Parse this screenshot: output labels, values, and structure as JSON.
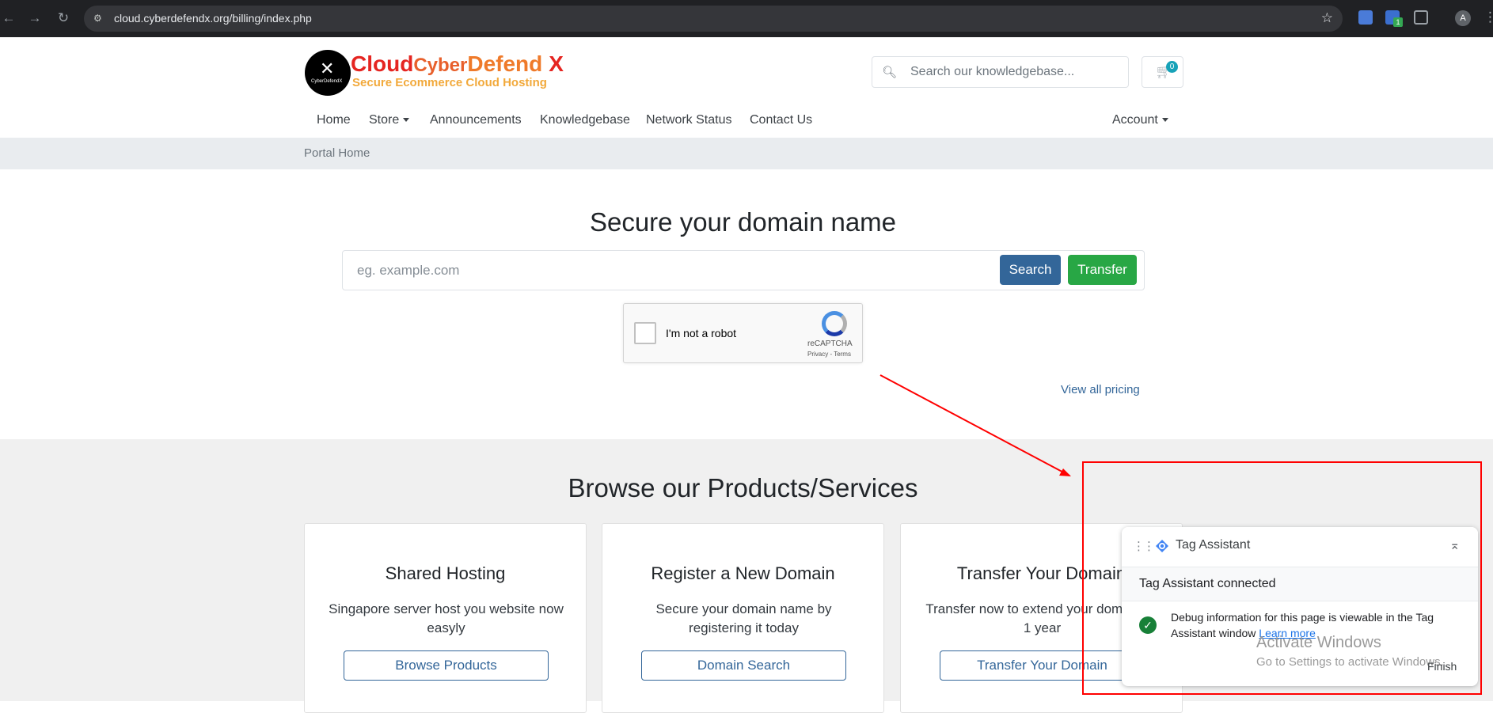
{
  "browser": {
    "url": "cloud.cyberdefendx.org/billing/index.php",
    "ext_badge": "1",
    "profile_initial": "A"
  },
  "brand": {
    "word1": "Cloud",
    "word2": "Cyber",
    "word3": "Defend",
    "word4": "X",
    "tagline": "Secure Ecommerce Cloud Hosting",
    "logo_caption": "CyberDefendX"
  },
  "header": {
    "kb_placeholder": "Search our knowledgebase...",
    "cart_count": "0"
  },
  "nav": {
    "home": "Home",
    "store": "Store",
    "announcements": "Announcements",
    "knowledgebase": "Knowledgebase",
    "network_status": "Network Status",
    "contact_us": "Contact Us",
    "account": "Account"
  },
  "breadcrumb": {
    "portal_home": "Portal Home"
  },
  "domain": {
    "title": "Secure your domain name",
    "placeholder": "eg. example.com",
    "search_label": "Search",
    "transfer_label": "Transfer",
    "view_pricing": "View all pricing"
  },
  "captcha": {
    "label": "I'm not a robot",
    "brand": "reCAPTCHA",
    "terms": "Privacy - Terms"
  },
  "products": {
    "title": "Browse our Products/Services",
    "cards": [
      {
        "title": "Shared Hosting",
        "desc": "Singapore server host you website now easyly",
        "button": "Browse Products"
      },
      {
        "title": "Register a New Domain",
        "desc": "Secure your domain name by registering it today",
        "button": "Domain Search"
      },
      {
        "title": "Transfer Your Domain",
        "desc": "Transfer now to extend your domain by 1 year",
        "button": "Transfer Your Domain"
      }
    ]
  },
  "tag_assistant": {
    "title": "Tag Assistant",
    "connected": "Tag Assistant connected",
    "info": "Debug information for this page is viewable in the Tag Assistant window",
    "learn_more": "Learn more",
    "finish": "Finish"
  },
  "watermark": {
    "line1": "Activate Windows",
    "line2": "Go to Settings to activate Windows."
  },
  "colors": {
    "primary": "#336699",
    "success": "#28a745",
    "annotation": "#ff0000"
  }
}
